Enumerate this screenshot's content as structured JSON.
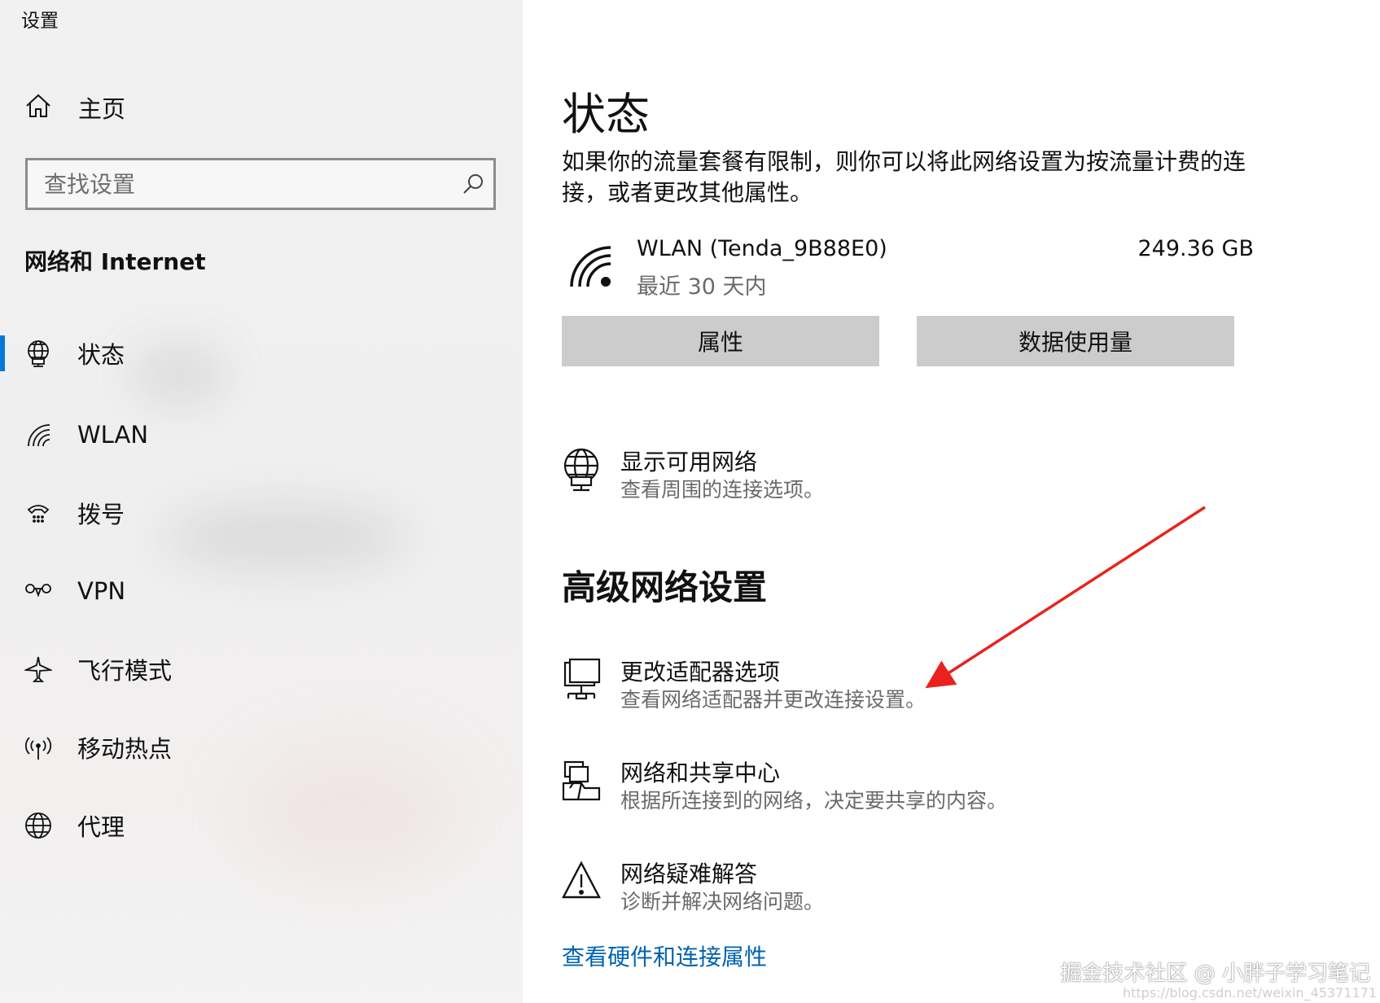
{
  "window": {
    "title": "设置"
  },
  "sidebar": {
    "home_label": "主页",
    "search": {
      "placeholder": "查找设置"
    },
    "section_title": "网络和 Internet",
    "items": [
      {
        "label": "状态",
        "icon": "status-globe-icon",
        "active": true
      },
      {
        "label": "WLAN",
        "icon": "wifi-icon"
      },
      {
        "label": "拨号",
        "icon": "dialup-icon"
      },
      {
        "label": "VPN",
        "icon": "vpn-icon"
      },
      {
        "label": "飞行模式",
        "icon": "airplane-icon"
      },
      {
        "label": "移动热点",
        "icon": "hotspot-icon"
      },
      {
        "label": "代理",
        "icon": "globe-icon"
      }
    ],
    "accent_color": "#0078d7"
  },
  "main": {
    "title": "状态",
    "description": "如果你的流量套餐有限制，则你可以将此网络设置为按流量计费的连接，或者更改其他属性。",
    "connection": {
      "name": "WLAN (Tenda_9B88E0)",
      "period": "最近 30 天内",
      "usage": "249.36 GB"
    },
    "buttons": {
      "properties": "属性",
      "data_usage": "数据使用量"
    },
    "show_networks": {
      "title": "显示可用网络",
      "subtitle": "查看周围的连接选项。"
    },
    "advanced_heading": "高级网络设置",
    "advanced_items": [
      {
        "title": "更改适配器选项",
        "subtitle": "查看网络适配器并更改连接设置。",
        "icon": "adapter-icon"
      },
      {
        "title": "网络和共享中心",
        "subtitle": "根据所连接到的网络，决定要共享的内容。",
        "icon": "sharing-center-icon"
      },
      {
        "title": "网络疑难解答",
        "subtitle": "诊断并解决网络问题。",
        "icon": "warning-icon"
      }
    ],
    "hardware_link": "查看硬件和连接属性",
    "link_color": "#0063b1"
  },
  "annotation": {
    "arrow_color": "#e8231f"
  },
  "watermark": {
    "text": "掘金技术社区 @ 小胖子学习笔记",
    "url": "https://blog.csdn.net/weixin_45371171"
  }
}
